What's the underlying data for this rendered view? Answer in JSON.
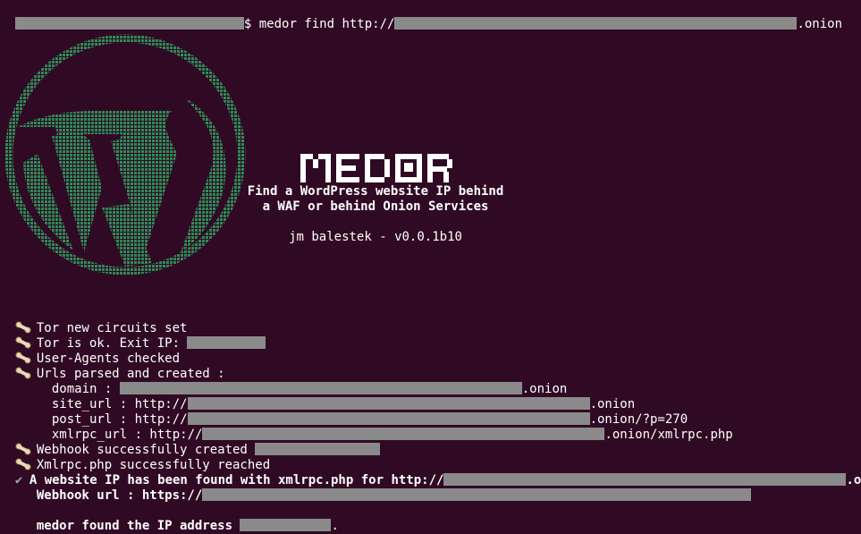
{
  "prompt": {
    "symbol": "$",
    "command": "medor find http://",
    "suffix": ".onion"
  },
  "banner": {
    "title": "MEDOR",
    "tagline_1": "Find a WordPress website IP behind",
    "tagline_2": "a WAF or behind Onion Services",
    "author": "jm balestek - v0.0.1b10"
  },
  "log": {
    "tor_circuits": "Tor new circuits set",
    "tor_ok": "Tor is ok. Exit IP:",
    "user_agents": "User-Agents checked",
    "urls_parsed": "Urls parsed and created :",
    "domain_label": "domain :",
    "domain_suffix": ".onion",
    "site_url_label": "site_url : http://",
    "site_url_suffix": ".onion",
    "post_url_label": "post_url : http://",
    "post_url_suffix": ".onion/?p=270",
    "xmlrpc_url_label": "xmlrpc_url : http://",
    "xmlrpc_url_suffix": ".onion/xmlrpc.php",
    "webhook_created": "Webhook successfully created",
    "xmlrpc_reached": "Xmlrpc.php successfully reached",
    "found_prefix": "A website IP has been found with xmlrpc.php for http://",
    "found_suffix": ".onion:",
    "webhook_url_label": "Webhook url : https://",
    "ip_found": "medor found the IP address",
    "ip_found_end": "."
  },
  "colors": {
    "background": "#300a24",
    "text": "#ffffff",
    "redaction": "#8a8a8a",
    "logo_green": "#2e8b57"
  },
  "icons": {
    "bone": "bone-icon",
    "check": "check-icon"
  }
}
